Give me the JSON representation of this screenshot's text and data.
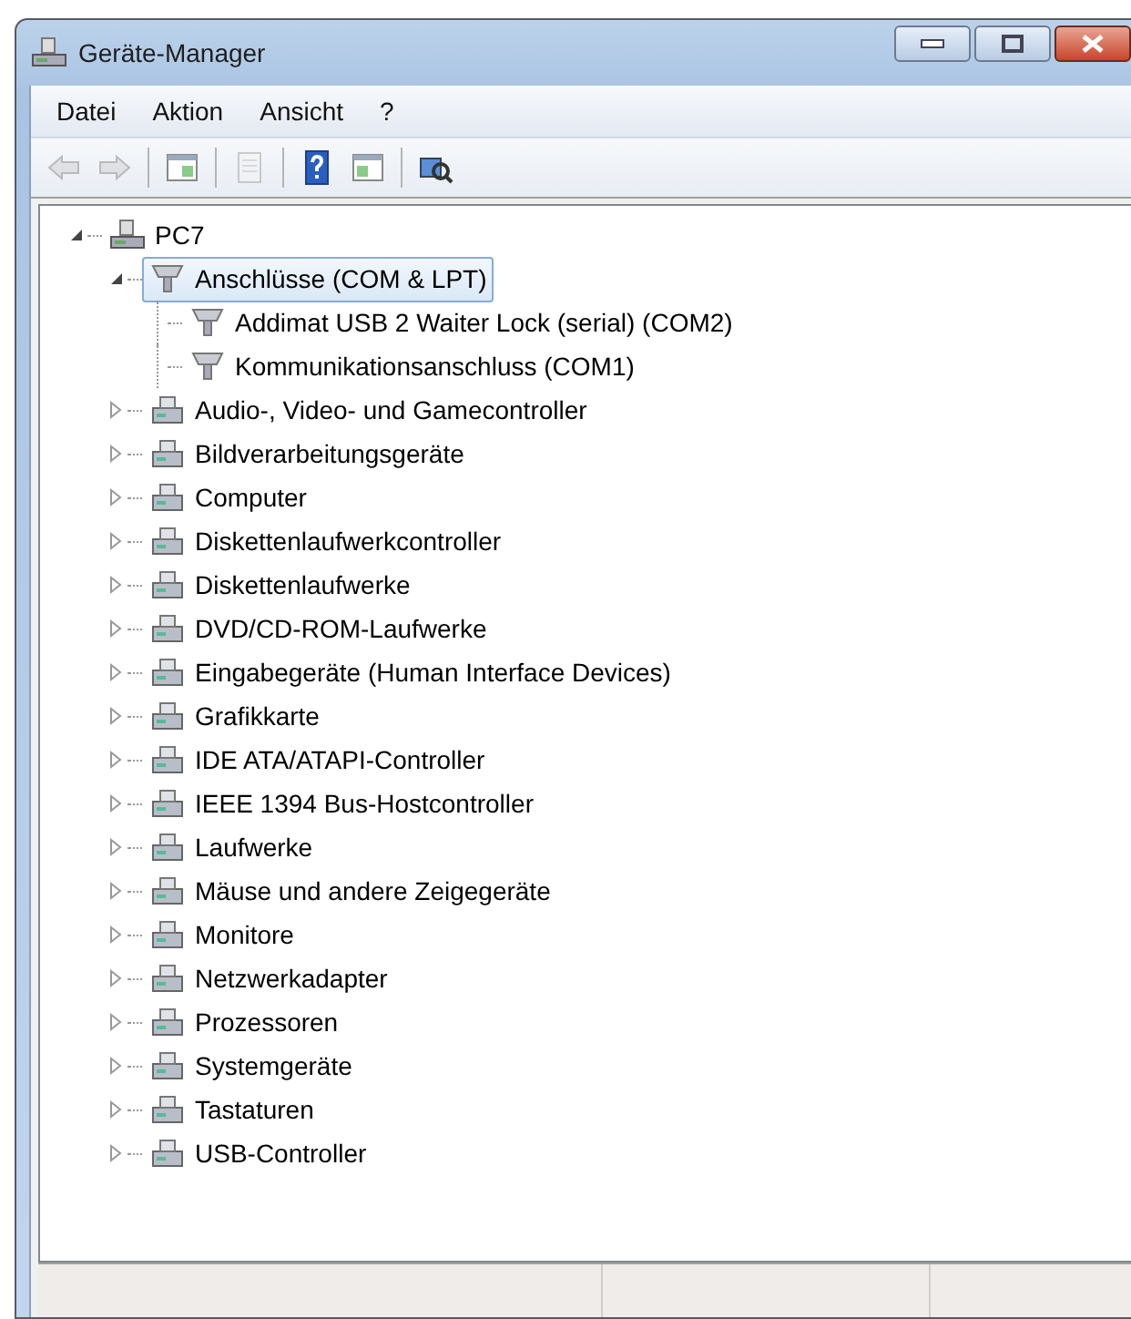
{
  "window": {
    "title": "Geräte-Manager"
  },
  "menu": [
    {
      "label": "Datei"
    },
    {
      "label": "Aktion"
    },
    {
      "label": "Ansicht"
    },
    {
      "label": "?"
    }
  ],
  "toolbar": [
    {
      "kind": "back",
      "disabled": true
    },
    {
      "kind": "forward",
      "disabled": true
    },
    {
      "kind": "separator"
    },
    {
      "kind": "tree",
      "disabled": false
    },
    {
      "kind": "separator"
    },
    {
      "kind": "properties",
      "disabled": true
    },
    {
      "kind": "separator"
    },
    {
      "kind": "help",
      "disabled": false
    },
    {
      "kind": "pane",
      "disabled": false
    },
    {
      "kind": "separator"
    },
    {
      "kind": "scan",
      "disabled": false
    }
  ],
  "tree": {
    "label": "PC7",
    "expanded": true,
    "selected": false,
    "children": [
      {
        "label": "Anschlüsse (COM & LPT)",
        "expanded": true,
        "selected": true,
        "children": [
          {
            "label": "Addimat USB 2 Waiter Lock (serial) (COM2)",
            "selected": false
          },
          {
            "label": "Kommunikationsanschluss (COM1)",
            "selected": false
          }
        ]
      },
      {
        "label": "Audio-, Video- und Gamecontroller",
        "expanded": false,
        "selected": false
      },
      {
        "label": "Bildverarbeitungsgeräte",
        "expanded": false,
        "selected": false
      },
      {
        "label": "Computer",
        "expanded": false,
        "selected": false
      },
      {
        "label": "Diskettenlaufwerkcontroller",
        "expanded": false,
        "selected": false
      },
      {
        "label": "Diskettenlaufwerke",
        "expanded": false,
        "selected": false
      },
      {
        "label": "DVD/CD-ROM-Laufwerke",
        "expanded": false,
        "selected": false
      },
      {
        "label": "Eingabegeräte (Human Interface Devices)",
        "expanded": false,
        "selected": false
      },
      {
        "label": "Grafikkarte",
        "expanded": false,
        "selected": false
      },
      {
        "label": "IDE ATA/ATAPI-Controller",
        "expanded": false,
        "selected": false
      },
      {
        "label": "IEEE 1394 Bus-Hostcontroller",
        "expanded": false,
        "selected": false
      },
      {
        "label": "Laufwerke",
        "expanded": false,
        "selected": false
      },
      {
        "label": "Mäuse und andere Zeigegeräte",
        "expanded": false,
        "selected": false
      },
      {
        "label": "Monitore",
        "expanded": false,
        "selected": false
      },
      {
        "label": "Netzwerkadapter",
        "expanded": false,
        "selected": false
      },
      {
        "label": "Prozessoren",
        "expanded": false,
        "selected": false
      },
      {
        "label": "Systemgeräte",
        "expanded": false,
        "selected": false
      },
      {
        "label": "Tastaturen",
        "expanded": false,
        "selected": false
      },
      {
        "label": "USB-Controller",
        "expanded": false,
        "selected": false
      }
    ]
  }
}
